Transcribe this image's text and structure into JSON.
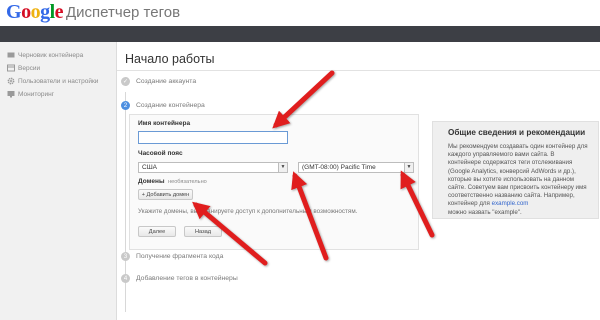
{
  "header": {
    "logo_letters": [
      {
        "ch": "G",
        "color": "#3369e8"
      },
      {
        "ch": "o",
        "color": "#d50f25"
      },
      {
        "ch": "o",
        "color": "#eeb211"
      },
      {
        "ch": "g",
        "color": "#3369e8"
      },
      {
        "ch": "l",
        "color": "#009925"
      },
      {
        "ch": "e",
        "color": "#d50f25"
      }
    ],
    "app_title": "Диспетчер тегов"
  },
  "sidebar": {
    "items": [
      {
        "label": "Черновик контейнера",
        "icon": "container-icon"
      },
      {
        "label": "Версии",
        "icon": "versions-icon"
      },
      {
        "label": "Пользователи и настройки",
        "icon": "gear-icon"
      },
      {
        "label": "Мониторинг",
        "icon": "monitor-icon"
      }
    ]
  },
  "main": {
    "title": "Начало работы",
    "steps": [
      {
        "label": "Создание аккаунта",
        "marker": "✓",
        "state": "done"
      },
      {
        "label": "Создание контейнера",
        "marker": "2",
        "state": "active"
      },
      {
        "label": "Получение фрагмента кода",
        "marker": "3",
        "state": "pending"
      },
      {
        "label": "Добавление тегов в контейнеры",
        "marker": "4",
        "state": "pending"
      }
    ],
    "form": {
      "name_label": "Имя контейнера",
      "name_value": "",
      "timezone_label": "Часовой пояс",
      "country_value": "США",
      "timezone_value": "(GMT-08:00) Pacific Time",
      "domains_label": "Домены",
      "domains_optional": "необязательно",
      "add_domain_button": "+ Добавить домен",
      "helper_text": "Укажите домены, вы планируете доступ к дополнительным возможностям.",
      "next_button": "Далее",
      "back_button": "Назад"
    },
    "info": {
      "title": "Общие сведения и рекомендации",
      "body": "Мы рекомендуем создавать один контейнер для каждого управляемого вами сайта. В контейнере содержатся теги отслеживания (Google Analytics, конверсий AdWords и др.), которые вы хотите использовать на данном сайте. Советуем вам присвоить контейнеру имя соответственно названию сайта. Например, контейнер для",
      "link": "example.com",
      "body_end": "можно назвать \"example\"."
    }
  },
  "colors": {
    "header_bar": "#3d3f45",
    "active_step": "#4d8fe0",
    "annotation_arrow": "#e01e1e"
  }
}
